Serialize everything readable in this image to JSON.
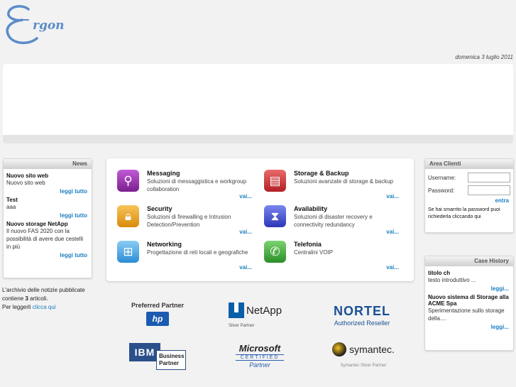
{
  "logo": {
    "text": "rgon"
  },
  "date": "domenica 3 luglio 2011",
  "news": {
    "title": "News",
    "items": [
      {
        "title": "Nuovo sito web",
        "text": "Nuovo sito web",
        "more": "leggi tutto"
      },
      {
        "title": "Test",
        "text": "aaa",
        "more": "leggi tutto"
      },
      {
        "title": "Nuovo storage NetApp",
        "text": "Il nuovo FAS 2020 con la possibilità di avere due cestelli in più",
        "more": "leggi tutto"
      }
    ]
  },
  "archive": {
    "line1": "L'archivio delle notizie pubblicate",
    "line2a": "contiene ",
    "count": "3",
    "line2b": " articoli.",
    "line3": "Per leggerli",
    "link": "clicca qui"
  },
  "services": [
    {
      "title": "Messaging",
      "desc": "Soluzioni di messaggistica e workgroup collaboration",
      "more": "vai...",
      "icon": "satellite-icon",
      "color": "#9a2fb0"
    },
    {
      "title": "Storage & Backup",
      "desc": "Soluzioni avanzate di storage & backup",
      "more": "vai...",
      "icon": "database-icon",
      "color": "#d4373b"
    },
    {
      "title": "Security",
      "desc": "Soluzioni di firewalling e Intrusion Detection/Prevention",
      "more": "vai...",
      "icon": "lock-icon",
      "color": "#f0a21c"
    },
    {
      "title": "Availability",
      "desc": "Soluzioni di disaster recovery e connectivity redundancy",
      "more": "vai...",
      "icon": "hourglass-icon",
      "color": "#3f4fd0"
    },
    {
      "title": "Networking",
      "desc": "Progettazione di reti locali e geografiche",
      "more": "vai...",
      "icon": "network-icon",
      "color": "#3aa0e0"
    },
    {
      "title": "Telefonia",
      "desc": "Centralini VOIP",
      "more": "vai...",
      "icon": "phone-icon",
      "color": "#3fae3b"
    }
  ],
  "area": {
    "title": "Area Clienti",
    "username_label": "Username:",
    "password_label": "Password:",
    "submit": "entra",
    "lost_password": "Se hai smarrito la password puoi richiederla cliccando qui"
  },
  "cases": {
    "title": "Case History",
    "items": [
      {
        "title": "titolo ch",
        "text": "testo introduttivo ...",
        "more": "leggi..."
      },
      {
        "title": "Nuovo sistema di Storage alla ACME Spa",
        "text": "Sperimentazione sullo storage della....",
        "more": "leggi..."
      }
    ]
  },
  "partners": {
    "hp_caption": "Preferred Partner",
    "hp_logo": "hp",
    "netapp_name": "NetApp",
    "netapp_caption": "Silver Partner",
    "nortel_name": "NORTEL",
    "nortel_caption": "Authorized Reseller",
    "ibm_name": "IBM",
    "ibm_caption": "Business Partner",
    "ms_name": "Microsoft",
    "ms_certified": "CERTIFIED",
    "ms_caption": "Partner",
    "symantec_name": "symantec.",
    "symantec_caption": "Symantec Silver Partner"
  }
}
